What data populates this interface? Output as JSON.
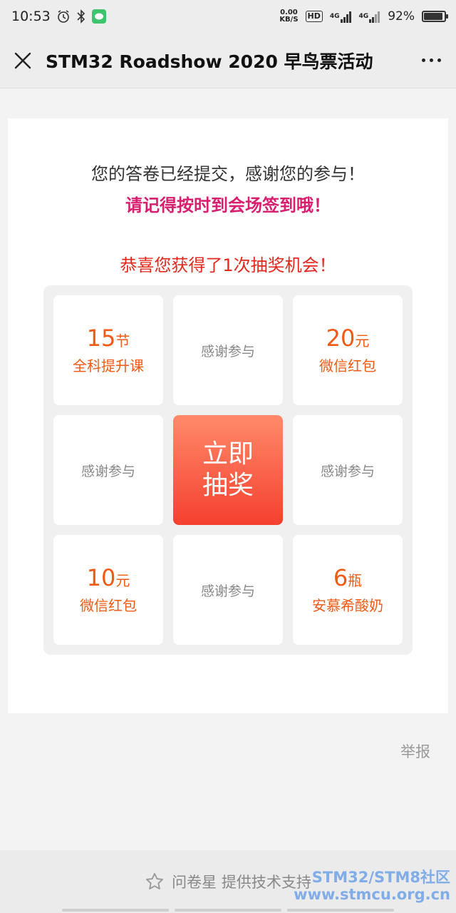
{
  "status_bar": {
    "time": "10:53",
    "net_speed_value": "0.00",
    "net_speed_unit": "KB/S",
    "hd_label": "HD",
    "signal1_label": "4G",
    "signal2_label": "4G",
    "battery_percent": "92%",
    "battery_level": 0.92
  },
  "title_bar": {
    "title": "STM32 Roadshow 2020 早鸟票活动"
  },
  "content": {
    "submitted_message": "您的答卷已经提交，感谢您的参与！",
    "reminder_message": "请记得按时到会场签到哦！",
    "lottery_message": "恭喜您获得了1次抽奖机会！",
    "grid": [
      {
        "num": "15",
        "unit": "节",
        "prize": "全科提升课"
      },
      {
        "thanks": "感谢参与"
      },
      {
        "num": "20",
        "unit": "元",
        "prize": "微信红包"
      },
      {
        "thanks": "感谢参与"
      },
      {
        "button_line1": "立即",
        "button_line2": "抽奖"
      },
      {
        "thanks": "感谢参与"
      },
      {
        "num": "10",
        "unit": "元",
        "prize": "微信红包"
      },
      {
        "thanks": "感谢参与"
      },
      {
        "num": "6",
        "unit": "瓶",
        "prize": "安慕希酸奶"
      }
    ],
    "report_label": "举报"
  },
  "footer": {
    "text": "问卷星 提供技术支持",
    "watermark_line1": "STM32/STM8社区",
    "watermark_line2": "www.stmcu.org.cn"
  },
  "colors": {
    "accent_magenta": "#d81e6e",
    "accent_red": "#e2281c",
    "prize_orange": "#f05a14",
    "button_gradient_top": "#ff8a6a",
    "button_gradient_bottom": "#f5402f"
  }
}
